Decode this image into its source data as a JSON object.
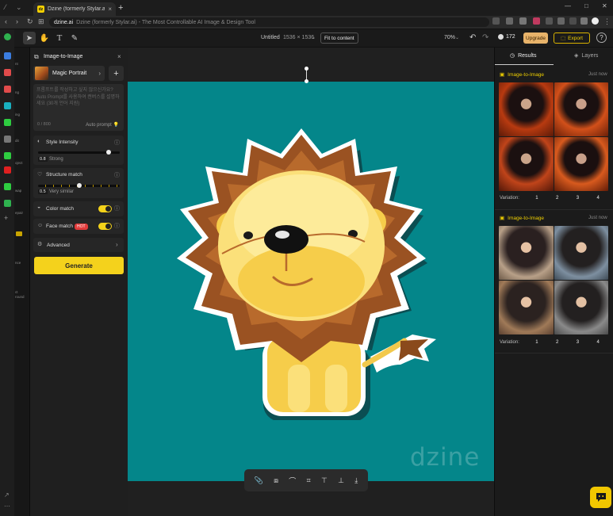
{
  "browser": {
    "tab_title": "Dzine (formerly Stylar.ai) - The",
    "tab_favicon": "dz",
    "url_domain": "dzine.ai",
    "url_rest": "Dzine (formerly Stylar.ai) - The Most Controllable AI Image & Design Tool"
  },
  "toolbar": {
    "doc_title": "Untitled",
    "doc_size": "1536 × 1536",
    "fit_label": "Fit to content",
    "zoom": "70%",
    "credits": "172",
    "upgrade_label": "Upgrade",
    "export_label": "Export",
    "help": "?"
  },
  "toolstrip_labels": [
    "nt",
    "ng",
    "ing",
    "dit",
    "oject",
    "wap",
    "epair",
    "nce",
    "ct round"
  ],
  "panel": {
    "title": "Image-to-Image",
    "preset_name": "Magic Portrait",
    "prompt_placeholder": "프롬프트를 작성하고 싶지 않으신가요? Auto Prompt를 사용하여 캔버스를 설명하세요 (30개 언어 지원)",
    "char_count": "0 / 800",
    "auto_prompt_label": "Auto prompt",
    "style_intensity": {
      "title": "Style Intensity",
      "value": "0.8",
      "value_text": "Strong",
      "fraction": 0.86
    },
    "structure_match": {
      "title": "Structure match",
      "value": "0.5",
      "value_text": "Very similar",
      "fraction": 0.5
    },
    "color_match": {
      "title": "Color match",
      "on": true
    },
    "face_match": {
      "title": "Face match",
      "badge": "HOT",
      "on": true
    },
    "advanced_label": "Advanced",
    "generate_label": "Generate"
  },
  "canvas": {
    "background": "#04868a",
    "watermark": "dzine"
  },
  "results_panel": {
    "tab_results": "Results",
    "tab_layers": "Layers",
    "groups": [
      {
        "title": "Image-to-Image",
        "time": "Just now",
        "variation_label": "Variation:",
        "variations": [
          "1",
          "2",
          "3",
          "4"
        ]
      },
      {
        "title": "Image-to-Image",
        "time": "Just now",
        "variation_label": "Variation:",
        "variations": [
          "1",
          "2",
          "3",
          "4"
        ]
      }
    ]
  },
  "colors": {
    "accent": "#f4d21c",
    "upgrade": "#e8b36a",
    "teal": "#04868a"
  }
}
